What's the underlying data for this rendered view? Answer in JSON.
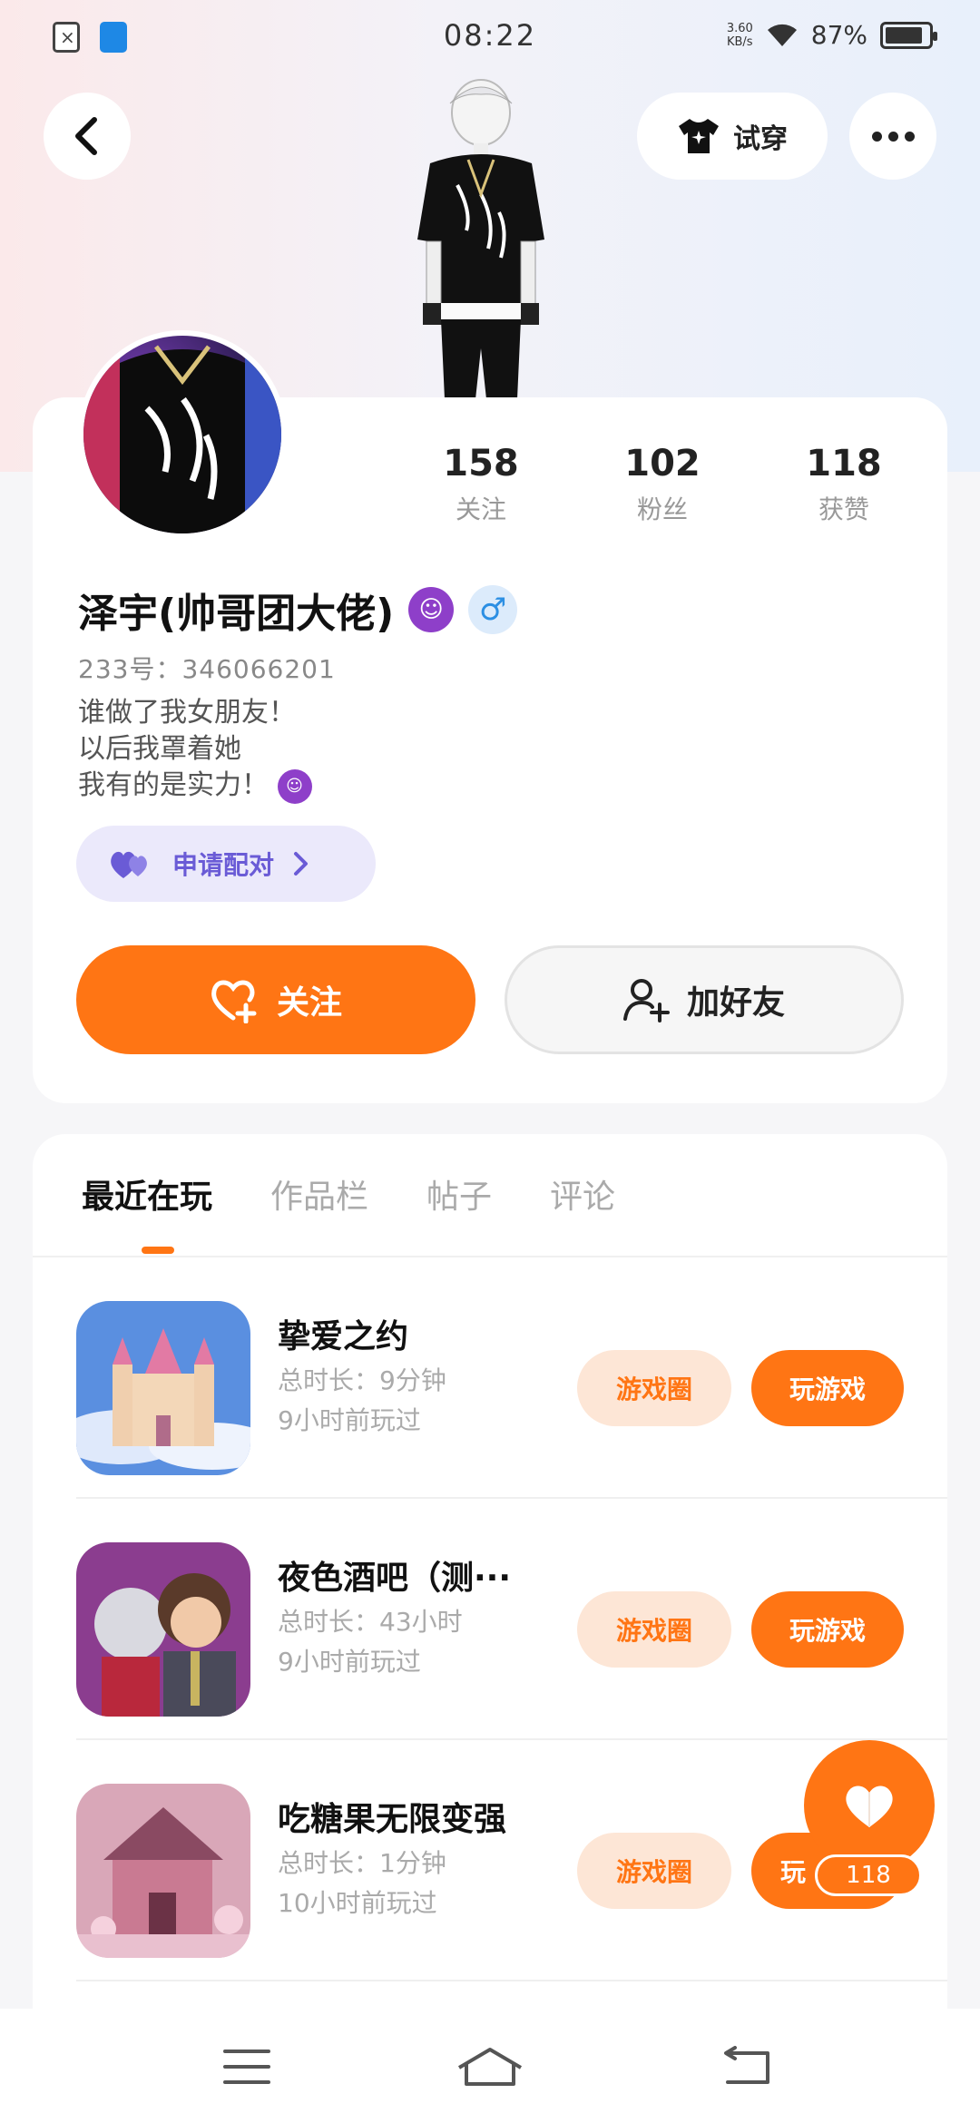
{
  "status_bar": {
    "time": "08:22",
    "net_speed_value": "3.60",
    "net_speed_unit": "KB/s",
    "battery": "87%",
    "battery_level": 0.87
  },
  "header": {
    "tryon_label": "试穿"
  },
  "profile": {
    "stats": [
      {
        "value": "158",
        "label": "关注"
      },
      {
        "value": "102",
        "label": "粉丝"
      },
      {
        "value": "118",
        "label": "获赞"
      }
    ],
    "name": "泽宇(帅哥团大佬)",
    "uid": "233号：346066201",
    "bio_line1": "谁做了我女朋友！",
    "bio_line2": "以后我罩着她",
    "bio_line3": "我有的是实力！",
    "pair_label": "申请配对",
    "follow_label": "关注",
    "add_friend_label": "加好友"
  },
  "tabs": [
    "最近在玩",
    "作品栏",
    "帖子",
    "评论"
  ],
  "games": [
    {
      "title": "挚爱之约",
      "duration": "总时长：9分钟",
      "last_played": "9小时前玩过",
      "circle_label": "游戏圈",
      "play_label": "玩游戏"
    },
    {
      "title": "夜色酒吧（测···",
      "duration": "总时长：43小时",
      "last_played": "9小时前玩过",
      "circle_label": "游戏圈",
      "play_label": "玩游戏"
    },
    {
      "title": "吃糖果无限变强",
      "duration": "总时长：1分钟",
      "last_played": "10小时前玩过",
      "circle_label": "游戏圈",
      "play_label": "玩"
    }
  ],
  "floating_like": {
    "count": "118"
  },
  "colors": {
    "accent": "#ff7514",
    "pair": "#6a5bd6",
    "gender": "#2c8fe3"
  }
}
